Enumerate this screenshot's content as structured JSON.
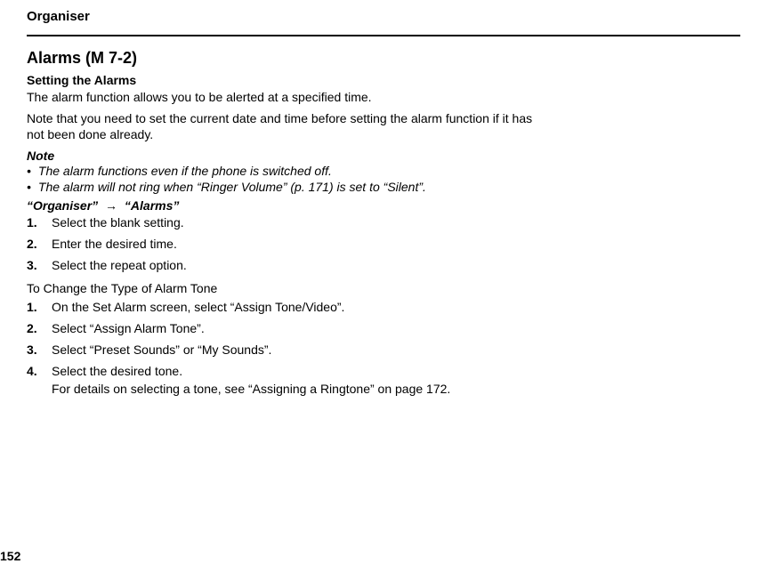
{
  "header": "Organiser",
  "section": {
    "title": "Alarms",
    "menu_code": "(M 7-2)"
  },
  "subsection": {
    "title": "Setting the Alarms",
    "intro": "The alarm function allows you to be alerted at a specified time.",
    "note_pre": "Note that you need to set the current date and time before setting the alarm function if it has not been done already."
  },
  "note": {
    "label": "Note",
    "items": [
      "The alarm functions even if the phone is switched off.",
      "The alarm will not ring when “Ringer Volume” (p. 171) is set to “Silent”."
    ]
  },
  "path": {
    "part1": "“Organiser”",
    "arrow": "→",
    "part2": "“Alarms”"
  },
  "steps1": [
    "Select the blank setting.",
    "Enter the desired time.",
    "Select the repeat option."
  ],
  "change_tone": {
    "heading": "To Change the Type of Alarm Tone",
    "steps": [
      "On the Set Alarm screen, select “Assign Tone/Video”.",
      "Select “Assign Alarm Tone”.",
      "Select “Preset Sounds” or “My Sounds”.",
      "Select the desired tone."
    ],
    "detail": "For details on selecting a tone, see “Assigning a Ringtone” on page 172."
  },
  "page_number": "152"
}
